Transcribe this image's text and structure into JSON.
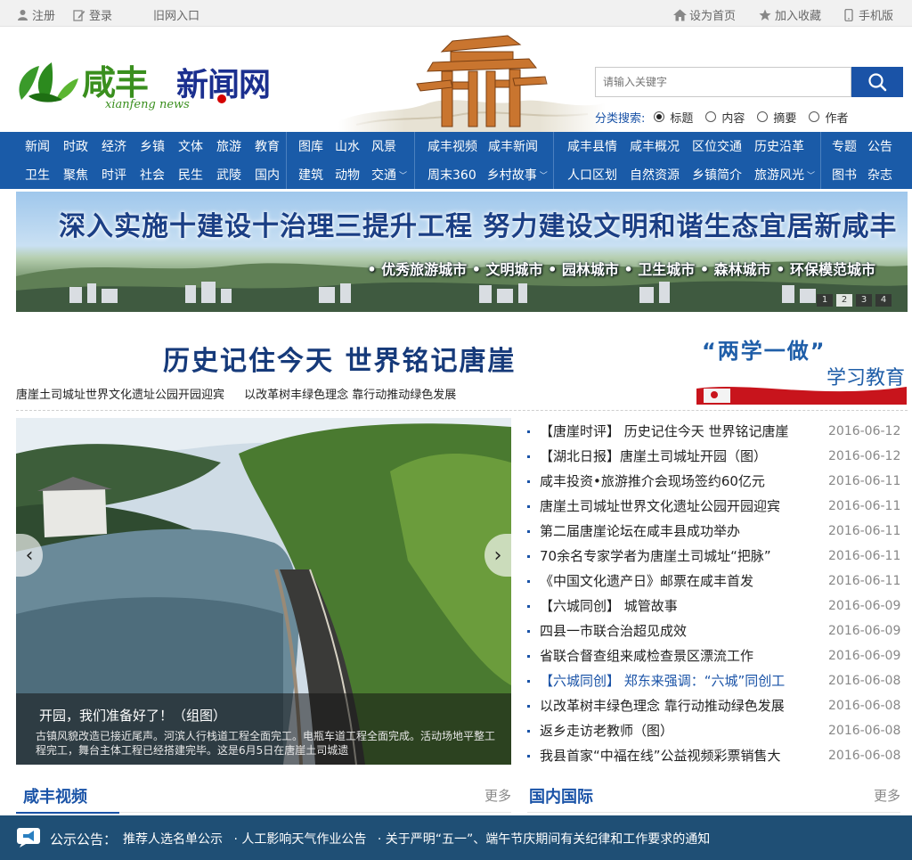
{
  "topbar": {
    "register": "注册",
    "login": "登录",
    "old_site": "旧网入口",
    "set_home": "设为首页",
    "favorite": "加入收藏",
    "mobile": "手机版"
  },
  "logo": {
    "cn_a": "咸丰",
    "cn_b": "新闻网",
    "en": "xianfeng news"
  },
  "search": {
    "placeholder": "请输入关键字",
    "filter_label": "分类搜索:",
    "options": [
      "标题",
      "内容",
      "摘要",
      "作者"
    ]
  },
  "nav": {
    "g1": {
      "row1": [
        "新闻",
        "时政",
        "经济",
        "乡镇",
        "文体",
        "旅游",
        "教育"
      ],
      "row2": [
        "卫生",
        "聚焦",
        "时评",
        "社会",
        "民生",
        "武陵",
        "国内"
      ]
    },
    "g2": {
      "row1": [
        "图库",
        "山水",
        "风景"
      ],
      "row2": [
        "建筑",
        "动物",
        "交通"
      ]
    },
    "g3": {
      "row1": [
        "咸丰视频",
        "咸丰新闻"
      ],
      "row2": [
        "周末360",
        "乡村故事"
      ]
    },
    "g4": {
      "row1": [
        "咸丰县情",
        "咸丰概况",
        "区位交通",
        "历史沿革"
      ],
      "row2": [
        "人口区划",
        "自然资源",
        "乡镇简介",
        "旅游风光"
      ]
    },
    "g5": {
      "row1": [
        "专题",
        "公告"
      ],
      "row2": [
        "图书",
        "杂志"
      ]
    }
  },
  "banner": {
    "title": "深入实施十建设十治理三提升工程 努力建设文明和谐生态宜居新咸丰",
    "subtitle": "• 优秀旅游城市   • 文明城市   • 园林城市   • 卫生城市   • 森林城市   • 环保模范城市",
    "pages": [
      "1",
      "2",
      "3",
      "4"
    ]
  },
  "headline": {
    "title": "历史记住今天    世界铭记唐崖",
    "links": [
      "唐崖土司城址世界文化遗址公园开园迎宾",
      "以改革树丰绿色理念 靠行动推动绿色发展"
    ]
  },
  "promo": {
    "line1": "“两学一做”",
    "line2": "学习教育"
  },
  "slider": {
    "caption_title": "开园，我们准备好了！（组图）",
    "caption_desc": "古镇风貌改造已接近尾声。河滨人行栈道工程全面完工。电瓶车道工程全面完成。活动场地平整工程完工，舞台主体工程已经搭建完毕。这是6月5日在唐崖土司城遗"
  },
  "news": [
    {
      "title": "【唐崖时评】 历史记住今天   世界铭记唐崖",
      "date": "2016-06-12",
      "blue": false
    },
    {
      "title": "【湖北日报】唐崖土司城址开园（图）",
      "date": "2016-06-12",
      "blue": false
    },
    {
      "title": "咸丰投资•旅游推介会现场签约60亿元",
      "date": "2016-06-11",
      "blue": false
    },
    {
      "title": "唐崖土司城址世界文化遗址公园开园迎宾",
      "date": "2016-06-11",
      "blue": false
    },
    {
      "title": "第二届唐崖论坛在咸丰县成功举办",
      "date": "2016-06-11",
      "blue": false
    },
    {
      "title": "70余名专家学者为唐崖土司城址“把脉”",
      "date": "2016-06-11",
      "blue": false
    },
    {
      "title": "《中国文化遗产日》邮票在咸丰首发",
      "date": "2016-06-11",
      "blue": false
    },
    {
      "title": "【六城同创】 城管故事",
      "date": "2016-06-09",
      "blue": false
    },
    {
      "title": "四县一市联合治超见成效",
      "date": "2016-06-09",
      "blue": false
    },
    {
      "title": "省联合督查组来咸检查景区漂流工作",
      "date": "2016-06-09",
      "blue": false
    },
    {
      "title": "【六城同创】 郑东来强调：“六城”同创工",
      "date": "2016-06-08",
      "blue": true
    },
    {
      "title": "以改革树丰绿色理念 靠行动推动绿色发展",
      "date": "2016-06-08",
      "blue": false
    },
    {
      "title": "返乡走访老教师（图）",
      "date": "2016-06-08",
      "blue": false
    },
    {
      "title": "我县首家“中福在线”公益视频彩票销售大",
      "date": "2016-06-08",
      "blue": false
    }
  ],
  "sections": {
    "video": {
      "title": "咸丰视频",
      "more": "更多"
    },
    "world": {
      "title": "国内国际",
      "more": "更多"
    }
  },
  "notice": {
    "label": "公示公告：",
    "items": [
      "推荐人选名单公示",
      "· 人工影响天气作业公告",
      "· 关于严明“五一”、端午节庆期间有关纪律和工作要求的通知"
    ]
  }
}
